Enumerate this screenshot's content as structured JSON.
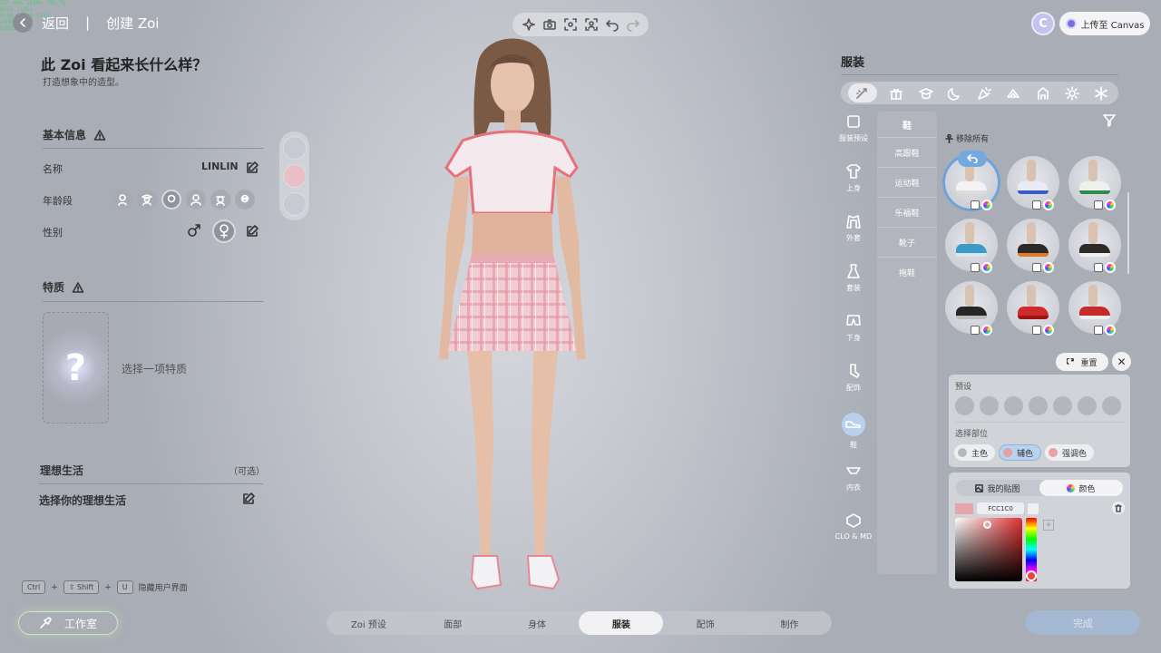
{
  "perf_overlay": [
    "55°    88%    1590%    105.7%",
    "6751   1165%    ",
    "553B   5531b   1453",
    "12MB   3968",
    "D3D12"
  ],
  "header": {
    "back_label": "返回",
    "separator": "|",
    "page_title": "创建 Zoi"
  },
  "account": {
    "avatar_letter": "C",
    "upload_label": "上传至 Canvas"
  },
  "left": {
    "title": "此 Zoi 看起来长什么样？",
    "subtitle": "打造想象中的造型。",
    "basic_info": "基本信息",
    "name_label": "名称",
    "name_value": "LINLIN",
    "age_label": "年龄段",
    "gender_label": "性别",
    "traits": "特质",
    "trait_prompt": "选择一项特质",
    "trait_placeholder": "?",
    "ideal_life": "理想生活",
    "optional": "（可选）",
    "ideal_prompt": "选择你的理想生活"
  },
  "shortcut": {
    "key1": "Ctrl",
    "key2": "⇧ Shift",
    "key3": "U",
    "plus": "+",
    "label": "隐藏用户界面"
  },
  "studio_label": "工作室",
  "tabs": [
    {
      "label": "Zoi 预设",
      "active": false
    },
    {
      "label": "面部",
      "active": false
    },
    {
      "label": "身体",
      "active": false
    },
    {
      "label": "服装",
      "active": true
    },
    {
      "label": "配饰",
      "active": false
    },
    {
      "label": "制作",
      "active": false
    }
  ],
  "done_label": "完成",
  "right": {
    "title": "服装",
    "left_categories": [
      {
        "label": "服装预设"
      },
      {
        "label": "上身"
      },
      {
        "label": "外套"
      },
      {
        "label": "套装"
      },
      {
        "label": "下身"
      },
      {
        "label": "配饰"
      },
      {
        "label": "鞋",
        "active": true
      },
      {
        "label": "内衣"
      },
      {
        "label": "CLO & MD"
      }
    ],
    "sub_header": "鞋",
    "sub_items": [
      "高跟鞋",
      "运动鞋",
      "乐福鞋",
      "靴子",
      "拖鞋"
    ],
    "remove_all": "移除所有",
    "shoes": [
      {
        "color": "#f3f3f5",
        "sole": "#dcdcdc"
      },
      {
        "color": "#e9ecf4",
        "sole": "#3a5bd0"
      },
      {
        "color": "#eef2ee",
        "sole": "#2f8a4d"
      },
      {
        "color": "#3a9bc8",
        "sole": "#d8e7ee"
      },
      {
        "color": "#2a2a2a",
        "sole": "#e47a20"
      },
      {
        "color": "#2d2a28",
        "sole": "#f0f0f0"
      },
      {
        "color": "#262626",
        "sole": "#bbbbbb"
      },
      {
        "color": "#cf2b2b",
        "sole": "#9a1515"
      },
      {
        "color": "#c72a2a",
        "sole": "#efefef"
      }
    ],
    "reset_label": "重置",
    "close_label": "✕",
    "preset_label": "预设",
    "part_label": "选择部位",
    "parts": [
      {
        "label": "主色",
        "color": "#b9b9bd"
      },
      {
        "label": "辅色",
        "color": "#e59fa5",
        "active": true
      },
      {
        "label": "强调色",
        "color": "#e8a1a6"
      }
    ],
    "panel_tabs": [
      {
        "label": "我的贴图"
      },
      {
        "label": "颜色",
        "active": true
      }
    ],
    "hex_value": "FCC1C0",
    "add_label": "+"
  }
}
